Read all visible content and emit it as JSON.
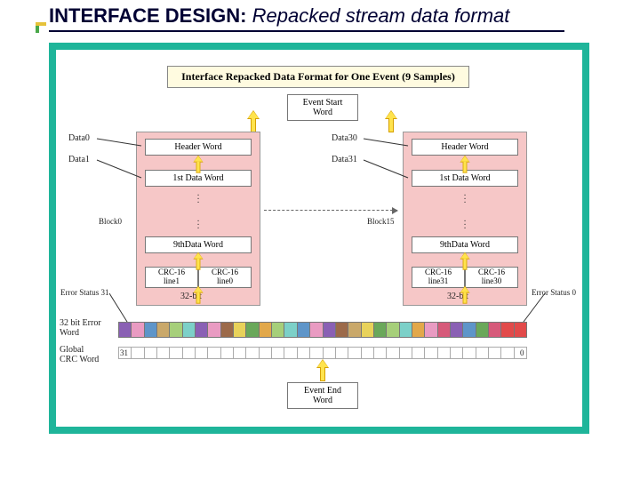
{
  "title_bold": "INTERFACE DESIGN:",
  "title_ital": "Repacked stream data format",
  "subtitle": "Interface Repacked Data Format for One Event (9 Samples)",
  "boxes": {
    "eventStart": "Event Start\nWord",
    "eventEnd": "Event End\nWord",
    "header": "Header Word",
    "firstData": "1st Data Word",
    "ninthData": "9thData Word",
    "crcA_l": "CRC-16\nline1",
    "crcA_r": "CRC-16\nline0",
    "crcB_l": "CRC-16\nline31",
    "crcB_r": "CRC-16\nline30",
    "bits": "32-bit"
  },
  "labels": {
    "data0": "Data0",
    "data1": "Data1",
    "data30": "Data30",
    "data31": "Data31",
    "block0": "Block0",
    "block15": "Block15",
    "errL": "32 bit Error\nWord",
    "errStatus31": "Error Status 31",
    "errStatus0": "Error Status 0",
    "crcWord": "Global\nCRC Word",
    "bit31": "31",
    "bit0": "0"
  }
}
